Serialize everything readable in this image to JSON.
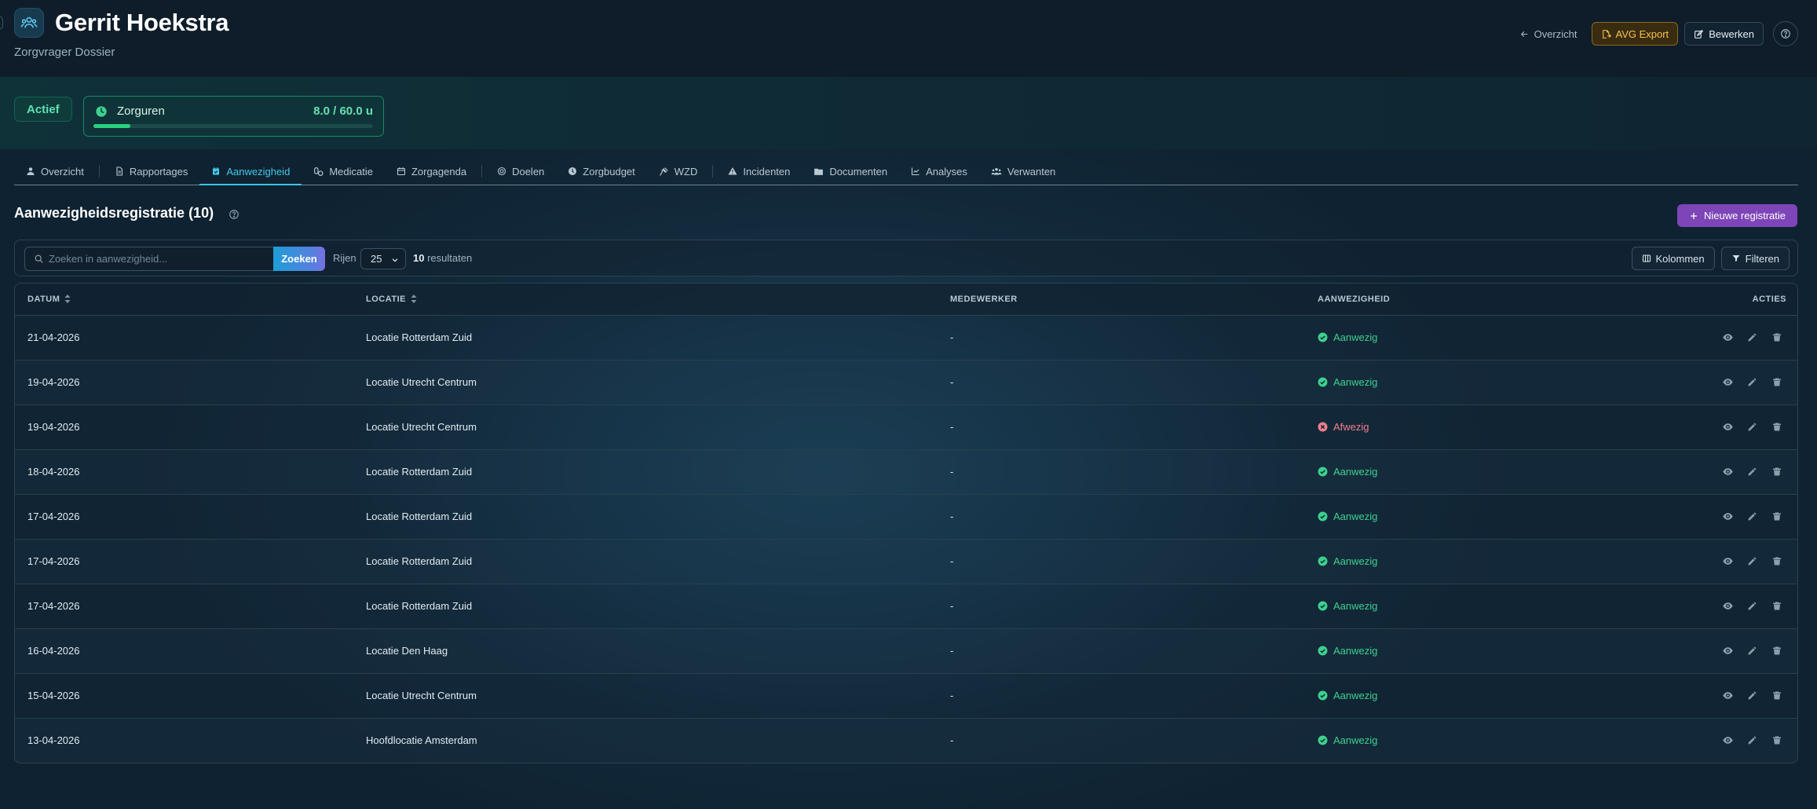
{
  "header": {
    "title": "Gerrit Hoekstra",
    "subtitle": "Zorgvrager Dossier",
    "back_label": "Overzicht",
    "export_label": "AVG Export",
    "edit_label": "Bewerken"
  },
  "summary": {
    "status": "Actief",
    "hours_label": "Zorguren",
    "hours_value": "8.0 / 60.0 u",
    "hours_progress": 0.133
  },
  "tabs": [
    {
      "label": "Overzicht",
      "icon": "user-icon"
    },
    {
      "label": "Rapportages",
      "icon": "document-icon"
    },
    {
      "label": "Aanwezigheid",
      "icon": "calendar-check-icon",
      "active": true
    },
    {
      "label": "Medicatie",
      "icon": "pills-icon"
    },
    {
      "label": "Zorgagenda",
      "icon": "calendar-icon"
    },
    {
      "label": "Doelen",
      "icon": "target-icon"
    },
    {
      "label": "Zorgbudget",
      "icon": "coin-icon"
    },
    {
      "label": "WZD",
      "icon": "gavel-icon"
    },
    {
      "label": "Incidenten",
      "icon": "warning-icon"
    },
    {
      "label": "Documenten",
      "icon": "folder-icon"
    },
    {
      "label": "Analyses",
      "icon": "chart-icon"
    },
    {
      "label": "Verwanten",
      "icon": "users-icon"
    }
  ],
  "section": {
    "title": "Aanwezigheidsregistratie (10)",
    "new_label": "Nieuwe registratie"
  },
  "toolbar": {
    "search_placeholder": "Zoeken in aanwezigheid...",
    "search_button": "Zoeken",
    "rows_label": "Rijen",
    "rows_value": "25",
    "result_count": "10",
    "result_suffix": "resultaten",
    "columns_label": "Kolommen",
    "filter_label": "Filteren"
  },
  "table": {
    "headers": {
      "date": "DATUM",
      "location": "LOCATIE",
      "employee": "MEDEWERKER",
      "presence": "AANWEZIGHEID",
      "actions": "ACTIES"
    },
    "rows": [
      {
        "date": "21-04-2026",
        "location": "Locatie Rotterdam Zuid",
        "employee": "-",
        "presence": "Aanwezig",
        "present": true
      },
      {
        "date": "19-04-2026",
        "location": "Locatie Utrecht Centrum",
        "employee": "-",
        "presence": "Aanwezig",
        "present": true
      },
      {
        "date": "19-04-2026",
        "location": "Locatie Utrecht Centrum",
        "employee": "-",
        "presence": "Afwezig",
        "present": false
      },
      {
        "date": "18-04-2026",
        "location": "Locatie Rotterdam Zuid",
        "employee": "-",
        "presence": "Aanwezig",
        "present": true
      },
      {
        "date": "17-04-2026",
        "location": "Locatie Rotterdam Zuid",
        "employee": "-",
        "presence": "Aanwezig",
        "present": true
      },
      {
        "date": "17-04-2026",
        "location": "Locatie Rotterdam Zuid",
        "employee": "-",
        "presence": "Aanwezig",
        "present": true
      },
      {
        "date": "17-04-2026",
        "location": "Locatie Rotterdam Zuid",
        "employee": "-",
        "presence": "Aanwezig",
        "present": true
      },
      {
        "date": "16-04-2026",
        "location": "Locatie Den Haag",
        "employee": "-",
        "presence": "Aanwezig",
        "present": true
      },
      {
        "date": "15-04-2026",
        "location": "Locatie Utrecht Centrum",
        "employee": "-",
        "presence": "Aanwezig",
        "present": true
      },
      {
        "date": "13-04-2026",
        "location": "Hoofdlocatie Amsterdam",
        "employee": "-",
        "presence": "Aanwezig",
        "present": true
      }
    ]
  },
  "colors": {
    "accent": "#3fc2e6",
    "primary": "#7d45b8",
    "present": "#3ed08f",
    "absent": "#f27f8a",
    "warning": "#f6c356"
  }
}
